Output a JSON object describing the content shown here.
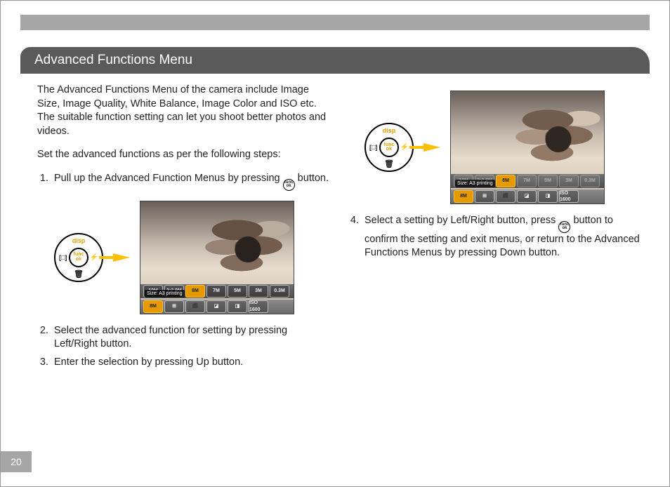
{
  "page_number": "20",
  "heading": "Advanced Functions Menu",
  "left": {
    "intro": "The Advanced Functions Menu of the camera include Image Size, Image Quality, White Balance, Image Color and ISO etc. The suitable function setting can let you shoot better photos and videos.",
    "steps_intro": "Set the advanced functions as per the following steps:",
    "step1_a": "Pull up the Advanced Function Menus by pressing ",
    "step1_b": " button.",
    "step2": "Select the advanced function for setting by pressing Left/Right button.",
    "step3": "Enter the selection by pressing Up button."
  },
  "right": {
    "step4_a": "Select a setting by Left/Right button, press ",
    "step4_b": " button to confirm the setting and exit menus, or return to the Advanced Functions Menus by pressing Down button."
  },
  "control": {
    "top": "disp",
    "left": "[□]",
    "right": "⚡",
    "bottom": "🗑",
    "center_top": "func",
    "center_bot": "ok"
  },
  "lcd": {
    "size_label": "Size: A3 printing",
    "top_icons": [
      "10M",
      "3:2 9M",
      "8M",
      "7M",
      "5M",
      "3M",
      "0.3M"
    ],
    "selected_top_index": 2,
    "bottom_icons": [
      "8M",
      "⊞",
      "⬛",
      "◪",
      "◨",
      "ISO 1600"
    ],
    "selected_bottom_index": 0
  }
}
